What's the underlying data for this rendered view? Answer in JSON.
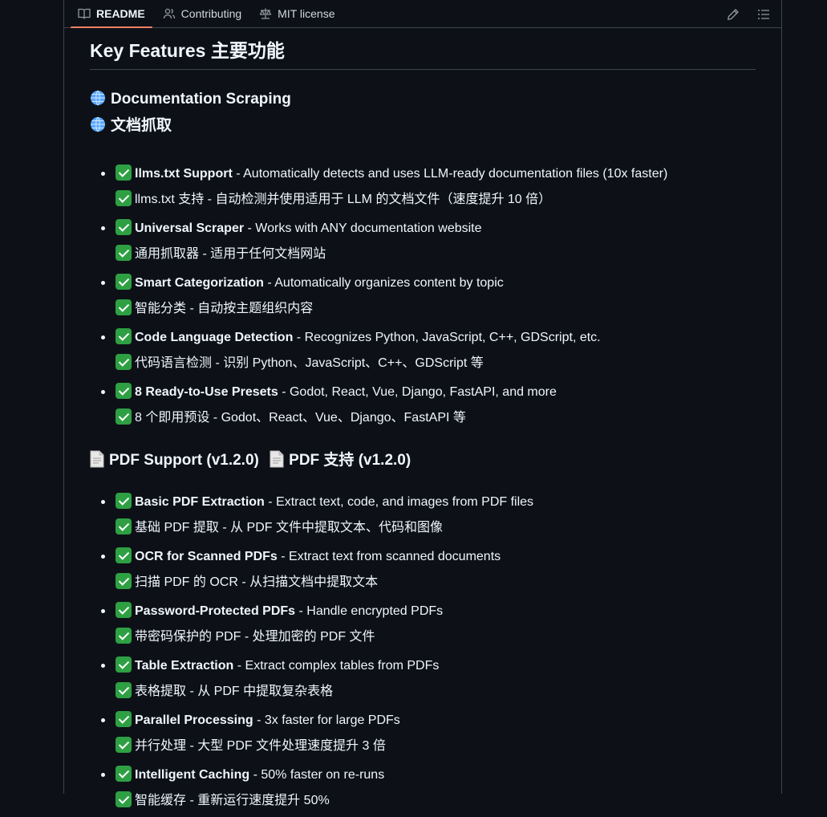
{
  "tabs": [
    {
      "label": "README",
      "icon": "book-icon",
      "active": true
    },
    {
      "label": "Contributing",
      "icon": "people-icon",
      "active": false
    },
    {
      "label": "MIT license",
      "icon": "law-icon",
      "active": false
    }
  ],
  "tools": {
    "edit_icon": "pencil-icon",
    "outline_icon": "list-icon"
  },
  "heading": "Key Features 主要功能",
  "section1": {
    "title_en": "Documentation Scraping",
    "title_zh": "文档抓取",
    "items": [
      {
        "bold": "llms.txt Support",
        "rest": " - Automatically detects and uses LLM-ready documentation files (10x faster)",
        "zh": "llms.txt 支持 - 自动检测并使用适用于 LLM 的文档文件（速度提升 10 倍）"
      },
      {
        "bold": "Universal Scraper",
        "rest": " - Works with ANY documentation website",
        "zh": "通用抓取器 - 适用于任何文档网站"
      },
      {
        "bold": "Smart Categorization",
        "rest": " - Automatically organizes content by topic",
        "zh": "智能分类 - 自动按主题组织内容"
      },
      {
        "bold": "Code Language Detection",
        "rest": " - Recognizes Python, JavaScript, C++, GDScript, etc.",
        "zh": "代码语言检测 - 识别 Python、JavaScript、C++、GDScript 等"
      },
      {
        "bold": "8 Ready-to-Use Presets",
        "rest": " - Godot, React, Vue, Django, FastAPI, and more",
        "zh": "8 个即用预设 - Godot、React、Vue、Django、FastAPI 等"
      }
    ]
  },
  "section2": {
    "title": "PDF Support (v1.2.0)",
    "title_zh": "PDF 支持 (v1.2.0)",
    "items": [
      {
        "bold": "Basic PDF Extraction",
        "rest": " - Extract text, code, and images from PDF files",
        "zh": "基础 PDF 提取 - 从 PDF 文件中提取文本、代码和图像"
      },
      {
        "bold": "OCR for Scanned PDFs",
        "rest": " - Extract text from scanned documents",
        "zh": "扫描 PDF 的 OCR - 从扫描文档中提取文本"
      },
      {
        "bold": "Password-Protected PDFs",
        "rest": " - Handle encrypted PDFs",
        "zh": "带密码保护的 PDF - 处理加密的 PDF 文件"
      },
      {
        "bold": "Table Extraction",
        "rest": " - Extract complex tables from PDFs",
        "zh": "表格提取 - 从 PDF 中提取复杂表格"
      },
      {
        "bold": "Parallel Processing",
        "rest": " - 3x faster for large PDFs",
        "zh": "并行处理 - 大型 PDF 文件处理速度提升 3 倍"
      },
      {
        "bold": "Intelligent Caching",
        "rest": " - 50% faster on re-runs",
        "zh": "智能缓存 - 重新运行速度提升 50%"
      }
    ]
  },
  "colors": {
    "background": "#0d1117",
    "text": "#f0f6fc",
    "border": "#3d444d",
    "active_tab_underline": "#f78166",
    "check_green": "#2ea043"
  }
}
